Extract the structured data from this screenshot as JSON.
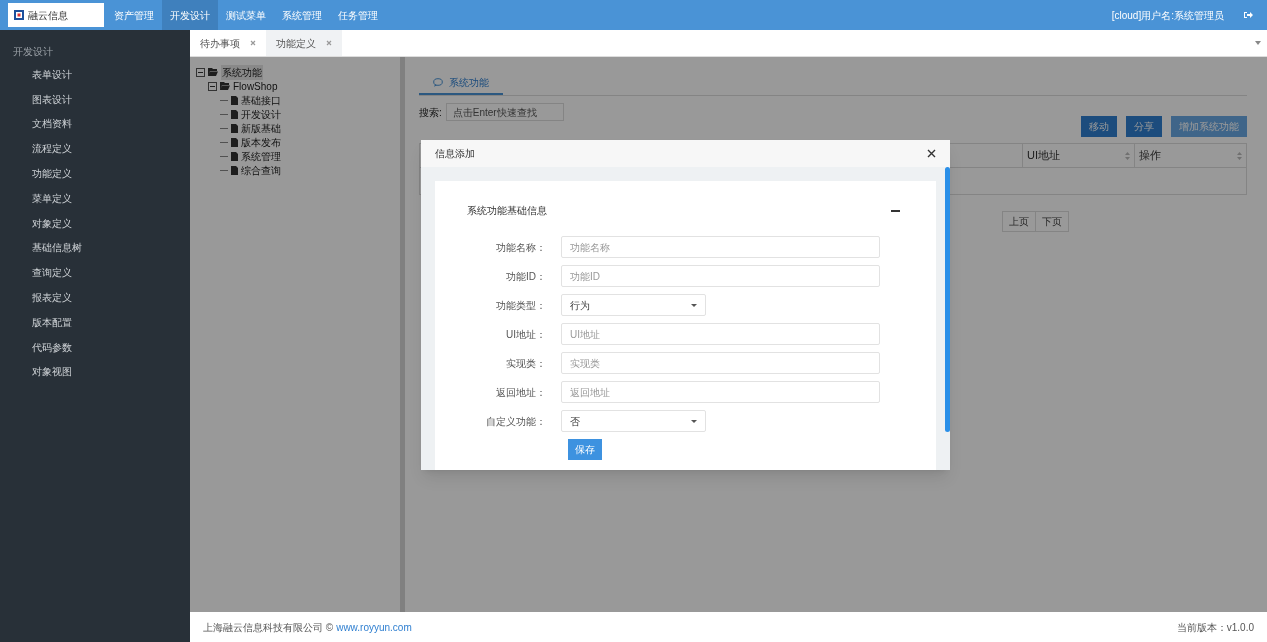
{
  "logo": {
    "text": "融云信息"
  },
  "top_nav": [
    {
      "label": "资产管理",
      "selected": false
    },
    {
      "label": "开发设计",
      "selected": true
    },
    {
      "label": "测试菜单",
      "selected": false
    },
    {
      "label": "系统管理",
      "selected": false
    },
    {
      "label": "任务管理",
      "selected": false
    }
  ],
  "user": {
    "text": "[cloud]用户名:系统管理员"
  },
  "sidebar": {
    "heading": "开发设计",
    "items": [
      "表单设计",
      "图表设计",
      "文档资料",
      "流程定义",
      "功能定义",
      "菜单定义",
      "对象定义",
      "基础信息树",
      "查询定义",
      "报表定义",
      "版本配置",
      "代码参数",
      "对象视图"
    ]
  },
  "tabs": [
    {
      "label": "待办事项",
      "selected": true
    },
    {
      "label": "功能定义",
      "selected": false
    }
  ],
  "tree": [
    {
      "label": "系统功能",
      "expanded": true,
      "children": [
        {
          "label": "FlowShop",
          "expanded": true,
          "children": [
            {
              "label": "基础接口"
            },
            {
              "label": "开发设计"
            },
            {
              "label": "新版基础"
            },
            {
              "label": "版本发布"
            },
            {
              "label": "系统管理"
            },
            {
              "label": "综合查询"
            }
          ]
        }
      ]
    }
  ],
  "panel": {
    "tab": "系统功能",
    "search_label": "搜索:",
    "search_placeholder": "点击Enter快速查找",
    "buttons": [
      {
        "label": "移动",
        "disabled": false
      },
      {
        "label": "分享",
        "disabled": false
      },
      {
        "label": "增加系统功能",
        "disabled": true
      }
    ],
    "columns": [
      "UI地址",
      "操作"
    ],
    "pager": [
      "上页",
      "下页"
    ]
  },
  "dialog": {
    "title": "信息添加",
    "section": "系统功能基础信息",
    "fields": [
      {
        "kind": "text",
        "label": "功能名称：",
        "placeholder": "功能名称"
      },
      {
        "kind": "text",
        "label": "功能ID：",
        "placeholder": "功能ID"
      },
      {
        "kind": "select",
        "label": "功能类型：",
        "value": "行为"
      },
      {
        "kind": "text",
        "label": "UI地址：",
        "placeholder": "UI地址"
      },
      {
        "kind": "text",
        "label": "实现类：",
        "placeholder": "实现类"
      },
      {
        "kind": "text",
        "label": "返回地址：",
        "placeholder": "返回地址"
      },
      {
        "kind": "select",
        "label": "自定义功能：",
        "value": "否"
      }
    ],
    "save": "保存"
  },
  "footer": {
    "company": "上海融云信息科技有限公司 ©",
    "link": "www.royyun.com",
    "version": "当前版本：v1.0.0"
  }
}
